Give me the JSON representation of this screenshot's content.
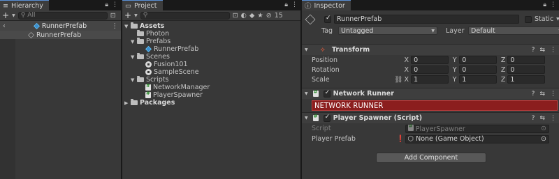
{
  "hierarchy": {
    "tab_label": "Hierarchy",
    "search_placeholder": "All",
    "scene_name": "RunnerPrefab",
    "items": [
      {
        "label": "RunnerPrefab"
      }
    ]
  },
  "project": {
    "tab_label": "Project",
    "search_placeholder": "",
    "hidden_count": "15",
    "tree": {
      "assets": "Assets",
      "photon": "Photon",
      "prefabs": "Prefabs",
      "runner_prefab": "RunnerPrefab",
      "scenes": "Scenes",
      "fusion101": "Fusion101",
      "sample_scene": "SampleScene",
      "scripts": "Scripts",
      "network_manager": "NetworkManager",
      "player_spawner": "PlayerSpawner",
      "packages": "Packages"
    }
  },
  "inspector": {
    "tab_label": "Inspector",
    "object_name": "RunnerPrefab",
    "static_label": "Static",
    "tag_label": "Tag",
    "tag_value": "Untagged",
    "layer_label": "Layer",
    "layer_value": "Default",
    "transform": {
      "title": "Transform",
      "position_label": "Position",
      "rotation_label": "Rotation",
      "scale_label": "Scale",
      "x": "X",
      "y": "Y",
      "z": "Z",
      "position": [
        "0",
        "0",
        "0"
      ],
      "rotation": [
        "0",
        "0",
        "0"
      ],
      "scale": [
        "1",
        "1",
        "1"
      ]
    },
    "network_runner": {
      "title": "Network Runner",
      "banner": "NETWORK RUNNER"
    },
    "player_spawner": {
      "title": "Player Spawner (Script)",
      "script_label": "Script",
      "script_value": "PlayerSpawner",
      "prefab_label": "Player Prefab",
      "prefab_value": "None (Game Object)"
    },
    "add_component": "Add Component"
  },
  "colors": {
    "banner_bg": "#8b1e1e",
    "tab_accent": "#5a8fd6",
    "prefab_blue": "#3a8fcf"
  }
}
